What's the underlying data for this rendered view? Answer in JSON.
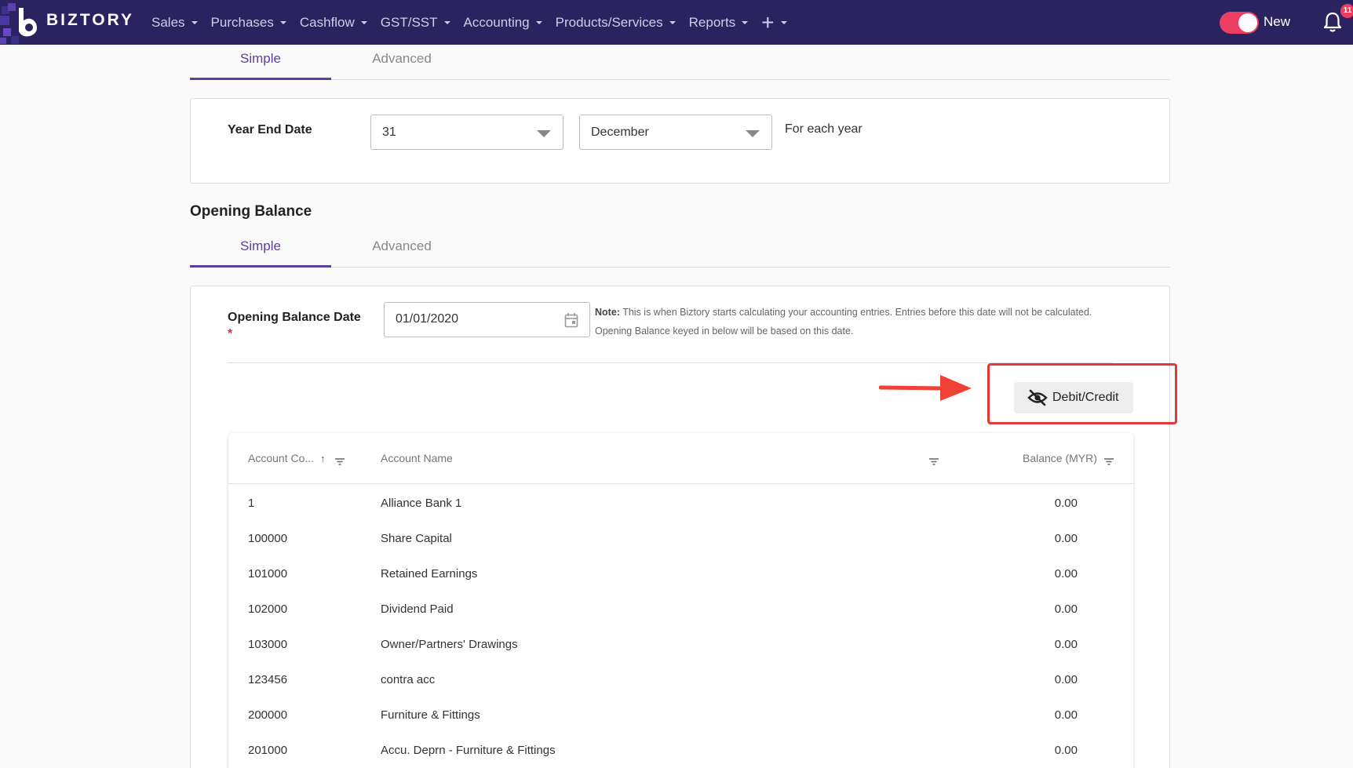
{
  "app": {
    "brand": "BIZTORY",
    "nav": [
      "Sales",
      "Purchases",
      "Cashflow",
      "GST/SST",
      "Accounting",
      "Products/Services",
      "Reports"
    ],
    "plus_icon": "+",
    "toggle_label": "New",
    "notification_count": "11",
    "accent_color": "#5e3f9d",
    "navbar_color": "#2a2360"
  },
  "year_end": {
    "tabs": [
      "Simple",
      "Advanced"
    ],
    "active_tab": "Simple",
    "label": "Year End Date",
    "day": "31",
    "month": "December",
    "suffix": "For each year"
  },
  "opening_balance": {
    "title": "Opening Balance",
    "tabs": [
      "Simple",
      "Advanced"
    ],
    "active_tab": "Simple",
    "date_label": "Opening Balance Date",
    "required_mark": "*",
    "date_value": "01/01/2020",
    "note_label": "Note:",
    "note_text": "This is when Biztory starts calculating your accounting entries. Entries before this date will not be calculated.",
    "note_text_2": "Opening Balance keyed in below will be based on this date.",
    "toggle_button": "Debit/Credit",
    "toggle_icon": "eye-off-icon"
  },
  "table": {
    "columns": [
      "Account Co...",
      "Account Name",
      "Balance (MYR)"
    ],
    "sort_indicator": "↑",
    "rows": [
      {
        "code": "1",
        "name": "Alliance Bank 1",
        "balance": "0.00"
      },
      {
        "code": "100000",
        "name": "Share Capital",
        "balance": "0.00"
      },
      {
        "code": "101000",
        "name": "Retained Earnings",
        "balance": "0.00"
      },
      {
        "code": "102000",
        "name": "Dividend Paid",
        "balance": "0.00"
      },
      {
        "code": "103000",
        "name": "Owner/Partners' Drawings",
        "balance": "0.00"
      },
      {
        "code": "123456",
        "name": "contra acc",
        "balance": "0.00"
      },
      {
        "code": "200000",
        "name": "Furniture & Fittings",
        "balance": "0.00"
      },
      {
        "code": "201000",
        "name": "Accu. Deprn - Furniture & Fittings",
        "balance": "0.00"
      }
    ]
  }
}
